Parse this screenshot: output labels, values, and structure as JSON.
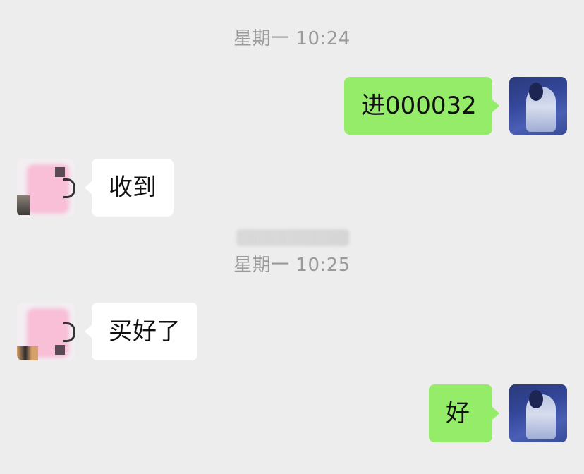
{
  "chat": {
    "timestamps": [
      "星期一 10:24",
      "星期一 10:25"
    ],
    "messages": [
      {
        "sender": "self",
        "text": "进000032"
      },
      {
        "sender": "other",
        "text": "收到"
      },
      {
        "sender": "other",
        "text": "买好了"
      },
      {
        "sender": "self",
        "text": "好"
      }
    ]
  },
  "colors": {
    "background": "#ededed",
    "self_bubble": "#95ec69",
    "other_bubble": "#ffffff",
    "timestamp_text": "#9a9a9a"
  }
}
